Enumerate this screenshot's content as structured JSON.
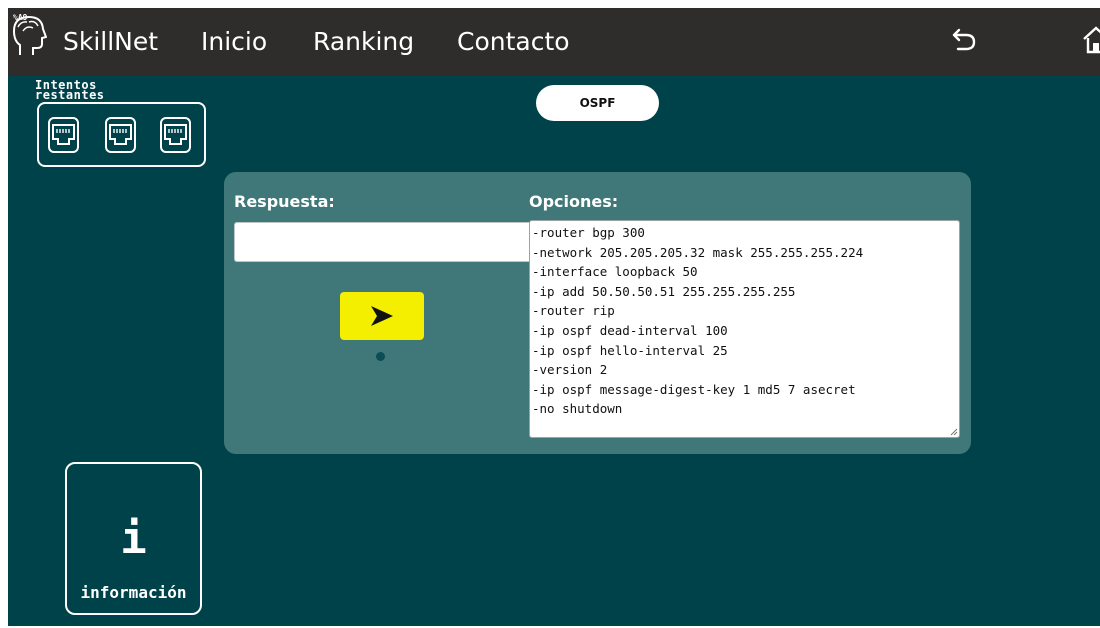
{
  "nav": {
    "brand": "SkillNet",
    "links": [
      "Inicio",
      "Ranking",
      "Contacto"
    ],
    "logo_icon": "brain-head-icon",
    "undo_icon": "undo-arrow-icon",
    "home_icon": "home-icon"
  },
  "attempts": {
    "label_line1": "Intentos",
    "label_line2": "restantes",
    "remaining": 3,
    "icon": "ethernet-port-icon"
  },
  "topic": "OSPF",
  "answer": {
    "label": "Respuesta:",
    "value": ""
  },
  "send_icon": "send-arrow-icon",
  "options": {
    "label": "Opciones:",
    "lines": [
      "-router bgp 300",
      "-network 205.205.205.32 mask 255.255.255.224",
      "-interface loopback 50",
      "-ip add 50.50.50.51 255.255.255.255",
      "-router rip",
      "-ip ospf dead-interval 100",
      "-ip ospf hello-interval 25",
      "-version 2",
      "-ip ospf message-digest-key 1 md5 7 asecret",
      "-no shutdown"
    ]
  },
  "info": {
    "icon_letter": "i",
    "label": "información"
  },
  "colors": {
    "background": "#00424a",
    "navbar": "#2e2d2b",
    "panel": "#40787a",
    "send_button": "#f4ef00"
  }
}
